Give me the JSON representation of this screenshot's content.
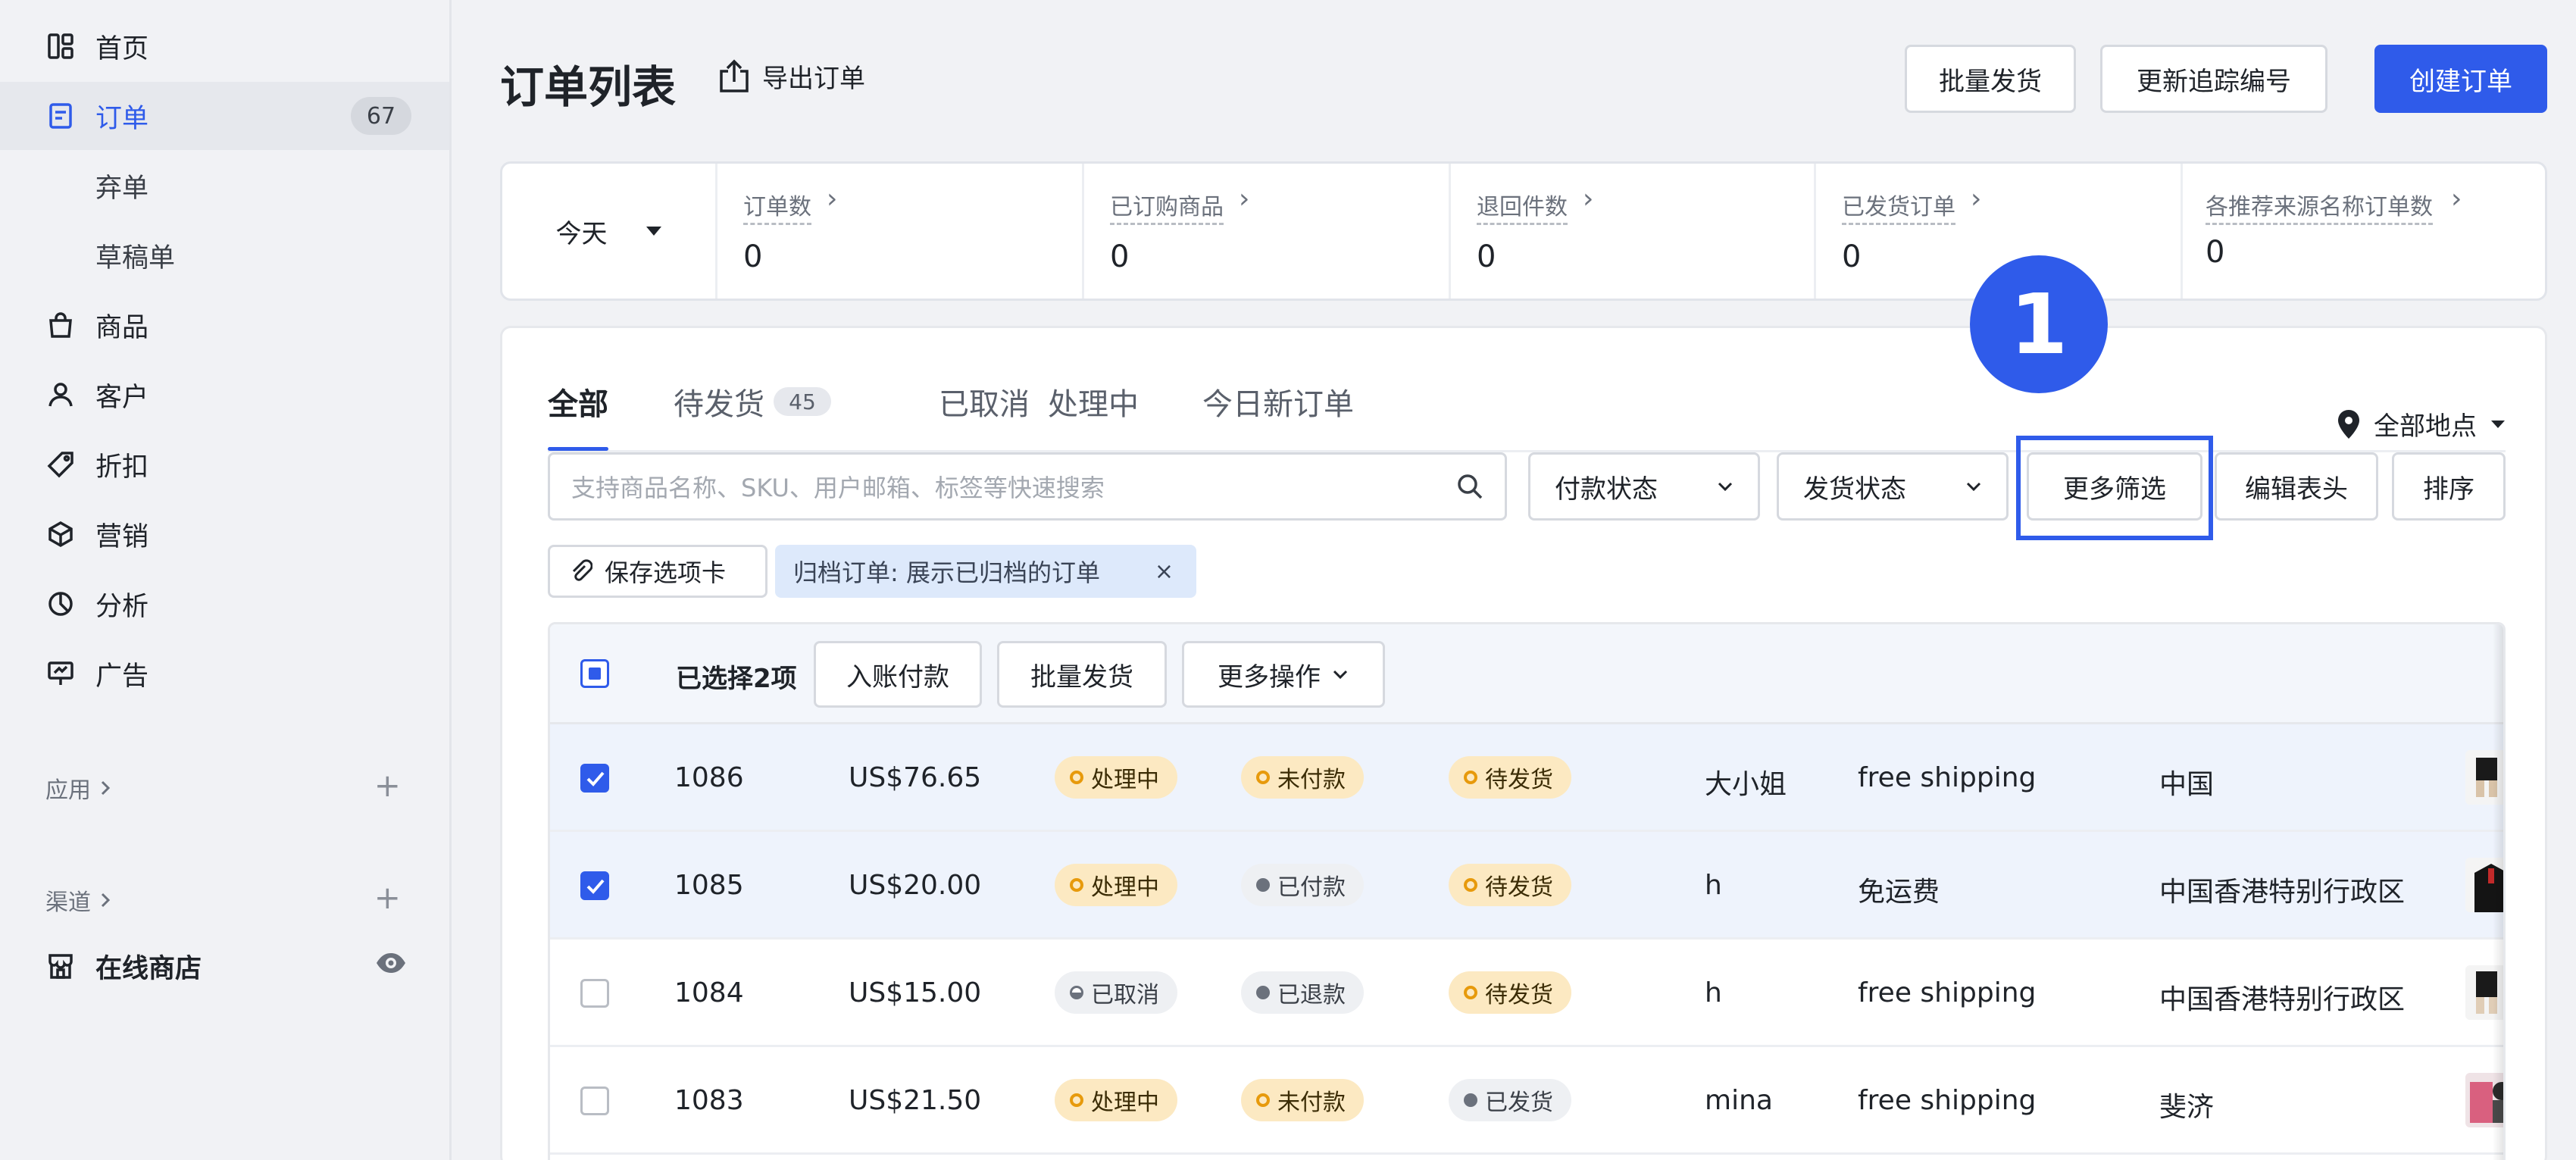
{
  "sidebar": {
    "items": [
      {
        "label": "首页",
        "icon": "home-grid-icon"
      },
      {
        "label": "订单",
        "icon": "order-doc-icon",
        "badge": "67",
        "active": true
      },
      {
        "label": "弃单",
        "sub": true
      },
      {
        "label": "草稿单",
        "sub": true
      },
      {
        "label": "商品",
        "icon": "shopping-bag-icon"
      },
      {
        "label": "客户",
        "icon": "user-icon"
      },
      {
        "label": "折扣",
        "icon": "tag-icon"
      },
      {
        "label": "营销",
        "icon": "cube-icon"
      },
      {
        "label": "分析",
        "icon": "pie-chart-icon"
      },
      {
        "label": "广告",
        "icon": "billboard-icon"
      }
    ],
    "apps_label": "应用",
    "channels_label": "渠道",
    "online_store_label": "在线商店"
  },
  "header": {
    "title": "订单列表",
    "export_label": "导出订单",
    "bulk_ship_label": "批量发货",
    "update_tracking_label": "更新追踪编号",
    "create_order_label": "创建订单"
  },
  "stats": {
    "period": "今天",
    "items": [
      {
        "label": "订单数",
        "value": "0"
      },
      {
        "label": "已订购商品",
        "value": "0"
      },
      {
        "label": "退回件数",
        "value": "0"
      },
      {
        "label": "已发货订单",
        "value": "0"
      },
      {
        "label": "各推荐来源名称订单数",
        "value": "0"
      }
    ]
  },
  "tabs": [
    {
      "label": "全部",
      "active": true
    },
    {
      "label": "待发货",
      "badge": "45"
    },
    {
      "label": "已取消"
    },
    {
      "label": "处理中"
    },
    {
      "label": "今日新订单"
    }
  ],
  "location_label": "全部地点",
  "filters": {
    "search_placeholder": "支持商品名称、SKU、用户邮箱、标签等快速搜索",
    "payment_status": "付款状态",
    "shipping_status": "发货状态",
    "more_filters": "更多筛选",
    "edit_columns": "编辑表头",
    "sort": "排序",
    "save_tab": "保存选项卡",
    "active_filter": "归档订单: 展示已归档的订单",
    "callout_number": "1"
  },
  "bulk": {
    "selected_label": "已选择2项",
    "mark_paid": "入账付款",
    "bulk_ship": "批量发货",
    "more_actions": "更多操作"
  },
  "orders": [
    {
      "id": "1086",
      "amount": "US$76.65",
      "status": "处理中",
      "payment": "未付款",
      "fulfillment": "待发货",
      "customer": "大小姐",
      "shipping": "free shipping",
      "region": "中国",
      "selected": true
    },
    {
      "id": "1085",
      "amount": "US$20.00",
      "status": "处理中",
      "payment": "已付款",
      "fulfillment": "待发货",
      "customer": "h",
      "shipping": "免运费",
      "region": "中国香港特别行政区",
      "selected": true
    },
    {
      "id": "1084",
      "amount": "US$15.00",
      "status": "已取消",
      "payment": "已退款",
      "fulfillment": "待发货",
      "customer": "h",
      "shipping": "free shipping",
      "region": "中国香港特别行政区",
      "selected": false
    },
    {
      "id": "1083",
      "amount": "US$21.50",
      "status": "处理中",
      "payment": "未付款",
      "fulfillment": "已发货",
      "customer": "mina",
      "shipping": "free shipping",
      "region": "斐济",
      "selected": false
    }
  ],
  "colors": {
    "accent": "#2f5bea",
    "warn_bg": "#fce9c2",
    "warn_dot": "#e79a0c",
    "grey_bg": "#eef0f3"
  }
}
